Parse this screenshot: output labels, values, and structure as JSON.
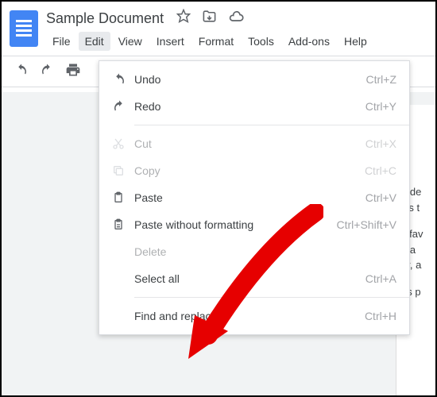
{
  "title": "Sample Document",
  "menubar": [
    "File",
    "Edit",
    "View",
    "Insert",
    "Format",
    "Tools",
    "Add-ons",
    "Help"
  ],
  "edit_menu": {
    "undo": {
      "label": "Undo",
      "shortcut": "Ctrl+Z"
    },
    "redo": {
      "label": "Redo",
      "shortcut": "Ctrl+Y"
    },
    "cut": {
      "label": "Cut",
      "shortcut": "Ctrl+X"
    },
    "copy": {
      "label": "Copy",
      "shortcut": "Ctrl+C"
    },
    "paste": {
      "label": "Paste",
      "shortcut": "Ctrl+V"
    },
    "paste_plain": {
      "label": "Paste without formatting",
      "shortcut": "Ctrl+Shift+V"
    },
    "delete": {
      "label": "Delete"
    },
    "select_all": {
      "label": "Select all",
      "shortcut": "Ctrl+A"
    },
    "find_replace": {
      "label": "Find and replace",
      "shortcut": "Ctrl+H"
    }
  },
  "doc_text": [
    "o de",
    "ws t",
    "",
    "y fav",
    " tha",
    "er, a",
    "",
    "ns p"
  ]
}
